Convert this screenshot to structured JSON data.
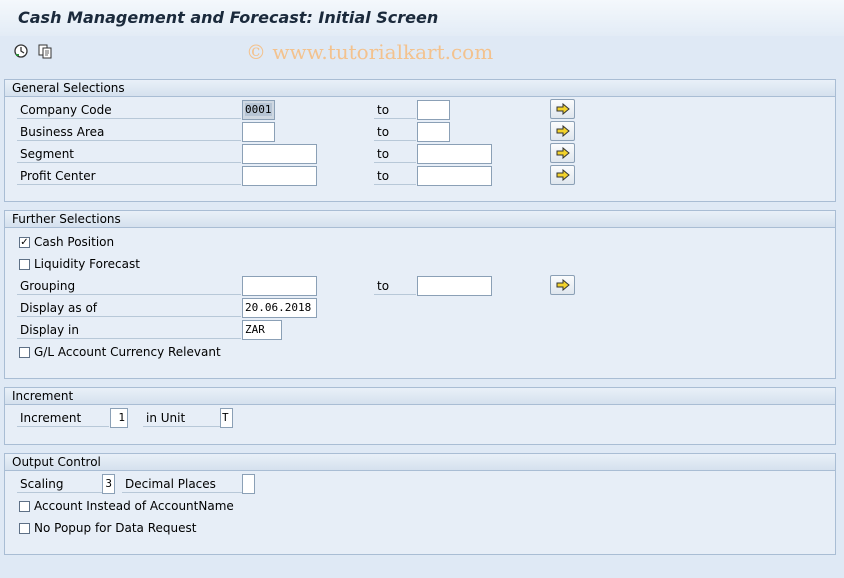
{
  "window": {
    "title": "Cash Management and Forecast: Initial Screen"
  },
  "toolbar": {
    "execute_icon": "execute-icon",
    "variants_icon": "get-variant-icon"
  },
  "watermark": "© www.tutorialkart.com",
  "general_selections": {
    "header": "General Selections",
    "rows": [
      {
        "label": "Company Code",
        "from": "0001",
        "to_label": "to",
        "to": ""
      },
      {
        "label": "Business Area",
        "from": "",
        "to_label": "to",
        "to": ""
      },
      {
        "label": "Segment",
        "from": "",
        "to_label": "to",
        "to": ""
      },
      {
        "label": "Profit Center",
        "from": "",
        "to_label": "to",
        "to": ""
      }
    ]
  },
  "further_selections": {
    "header": "Further Selections",
    "cash_position": {
      "label": "Cash Position",
      "checked": true
    },
    "liquidity_forecast": {
      "label": "Liquidity Forecast",
      "checked": false
    },
    "grouping": {
      "label": "Grouping",
      "from": "",
      "to_label": "to",
      "to": ""
    },
    "display_as_of": {
      "label": "Display as of",
      "value": "20.06.2018"
    },
    "display_in": {
      "label": "Display in",
      "value": "ZAR"
    },
    "gl_currency": {
      "label": "G/L Account Currency Relevant",
      "checked": false
    }
  },
  "increment": {
    "header": "Increment",
    "increment_label": "Increment",
    "increment_value": "1",
    "unit_label": "in Unit",
    "unit_value": "T"
  },
  "output_control": {
    "header": "Output Control",
    "scaling_label": "Scaling",
    "scaling_value": "3",
    "decimal_label": "Decimal Places",
    "decimal_value": "",
    "account_instead": {
      "label": "Account Instead of AccountName",
      "checked": false
    },
    "no_popup": {
      "label": "No Popup for Data Request",
      "checked": false
    }
  }
}
